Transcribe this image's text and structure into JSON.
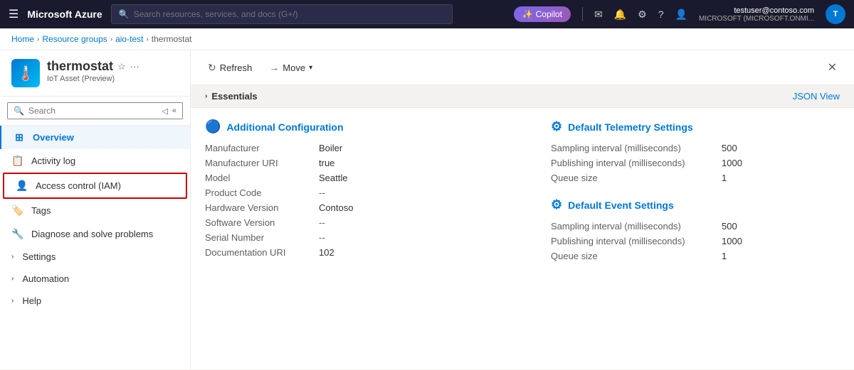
{
  "topNav": {
    "appName": "Microsoft Azure",
    "searchPlaceholder": "Search resources, services, and docs (G+/)",
    "copilotLabel": "Copilot",
    "userEmail": "testuser@contoso.com",
    "userTenant": "MICROSOFT (MICROSOFT.ONMI...",
    "userInitials": "T"
  },
  "breadcrumb": {
    "items": [
      "Home",
      "Resource groups",
      "aio-test",
      "thermostat"
    ]
  },
  "resourceHeader": {
    "title": "thermostat",
    "subtitle": "IoT Asset (Preview)",
    "icon": "🌡️"
  },
  "sidebar": {
    "searchPlaceholder": "Search",
    "navItems": [
      {
        "id": "overview",
        "label": "Overview",
        "icon": "⊞",
        "active": true
      },
      {
        "id": "activity-log",
        "label": "Activity log",
        "icon": "📋",
        "active": false
      },
      {
        "id": "access-control",
        "label": "Access control (IAM)",
        "icon": "👤",
        "active": false,
        "highlighted": true
      },
      {
        "id": "tags",
        "label": "Tags",
        "icon": "🏷️",
        "active": false
      },
      {
        "id": "diagnose",
        "label": "Diagnose and solve problems",
        "icon": "🔧",
        "active": false
      }
    ],
    "groups": [
      {
        "id": "settings",
        "label": "Settings",
        "expanded": false
      },
      {
        "id": "automation",
        "label": "Automation",
        "expanded": false
      },
      {
        "id": "help",
        "label": "Help",
        "expanded": false
      }
    ]
  },
  "toolbar": {
    "refreshLabel": "Refresh",
    "moveLabel": "Move"
  },
  "essentials": {
    "title": "Essentials",
    "jsonViewLabel": "JSON View"
  },
  "additionalConfig": {
    "sectionTitle": "Additional Configuration",
    "fields": [
      {
        "label": "Manufacturer",
        "value": "Boiler"
      },
      {
        "label": "Manufacturer URI",
        "value": "true"
      },
      {
        "label": "Model",
        "value": "Seattle"
      },
      {
        "label": "Product Code",
        "value": "--"
      },
      {
        "label": "Hardware Version",
        "value": "Contoso"
      },
      {
        "label": "Software Version",
        "value": "--"
      },
      {
        "label": "Serial Number",
        "value": "--"
      },
      {
        "label": "Documentation URI",
        "value": "102"
      }
    ]
  },
  "defaultTelemetry": {
    "sectionTitle": "Default Telemetry Settings",
    "fields": [
      {
        "label": "Sampling interval (milliseconds)",
        "value": "500"
      },
      {
        "label": "Publishing interval (milliseconds)",
        "value": "1000"
      },
      {
        "label": "Queue size",
        "value": "1"
      }
    ]
  },
  "defaultEvent": {
    "sectionTitle": "Default Event Settings",
    "fields": [
      {
        "label": "Sampling interval (milliseconds)",
        "value": "500"
      },
      {
        "label": "Publishing interval (milliseconds)",
        "value": "1000"
      },
      {
        "label": "Queue size",
        "value": "1"
      }
    ]
  }
}
